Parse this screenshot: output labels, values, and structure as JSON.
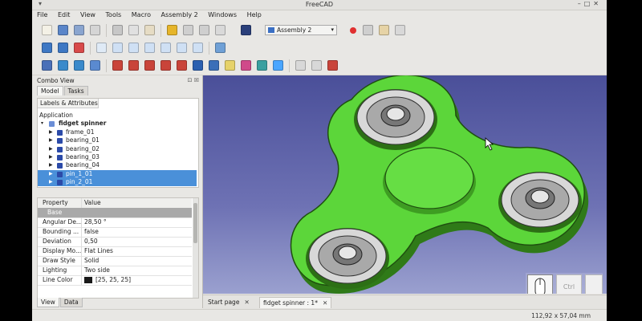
{
  "window": {
    "title": "FreeCAD",
    "menu_arrow": "▾",
    "controls": "–□✕"
  },
  "menu": [
    "File",
    "Edit",
    "View",
    "Tools",
    "Macro",
    "Assembly 2",
    "Windows",
    "Help"
  ],
  "toolbar": {
    "workbench": "Assembly 2",
    "workbench_arrow": "▾"
  },
  "combo_view": {
    "title": "Combo View",
    "title_buttons": "⊡ ☒",
    "tabs": [
      "Model",
      "Tasks"
    ],
    "labels_tab": "Labels & Attributes",
    "section": "Application",
    "root": "fidget spinner",
    "items": [
      {
        "label": "frame_01",
        "selected": false
      },
      {
        "label": "bearing_01",
        "selected": false
      },
      {
        "label": "bearing_02",
        "selected": false
      },
      {
        "label": "bearing_03",
        "selected": false
      },
      {
        "label": "bearing_04",
        "selected": false
      },
      {
        "label": "pin_1_01",
        "selected": true
      },
      {
        "label": "pin_2_01",
        "selected": true
      }
    ]
  },
  "properties": {
    "header": {
      "property": "Property",
      "value": "Value"
    },
    "group": "Base",
    "rows": [
      {
        "key": "Angular De...",
        "value": "28,50 °"
      },
      {
        "key": "Bounding ...",
        "value": "false"
      },
      {
        "key": "Deviation",
        "value": "0,50"
      },
      {
        "key": "Display Mo...",
        "value": "Flat Lines"
      },
      {
        "key": "Draw Style",
        "value": "Solid"
      },
      {
        "key": "Lighting",
        "value": "Two side"
      },
      {
        "key": "Line Color",
        "value": "[25, 25, 25]"
      }
    ],
    "bottom_tabs": [
      "View",
      "Data"
    ]
  },
  "documents": [
    {
      "label": "Start page",
      "close": "✕",
      "active": false
    },
    {
      "label": "fidget spinner : 1*",
      "close": "✕",
      "active": true
    }
  ],
  "nav": {
    "ctrl_label": "Ctrl"
  },
  "status": {
    "dimensions": "112,92 x 57,04 mm"
  },
  "colors": {
    "spinner": "#5cd63a",
    "bearing": "#c9c9c9",
    "background_top": "#4a4f99",
    "background_bottom": "#9aa0cf",
    "selection": "#4a90d9"
  }
}
